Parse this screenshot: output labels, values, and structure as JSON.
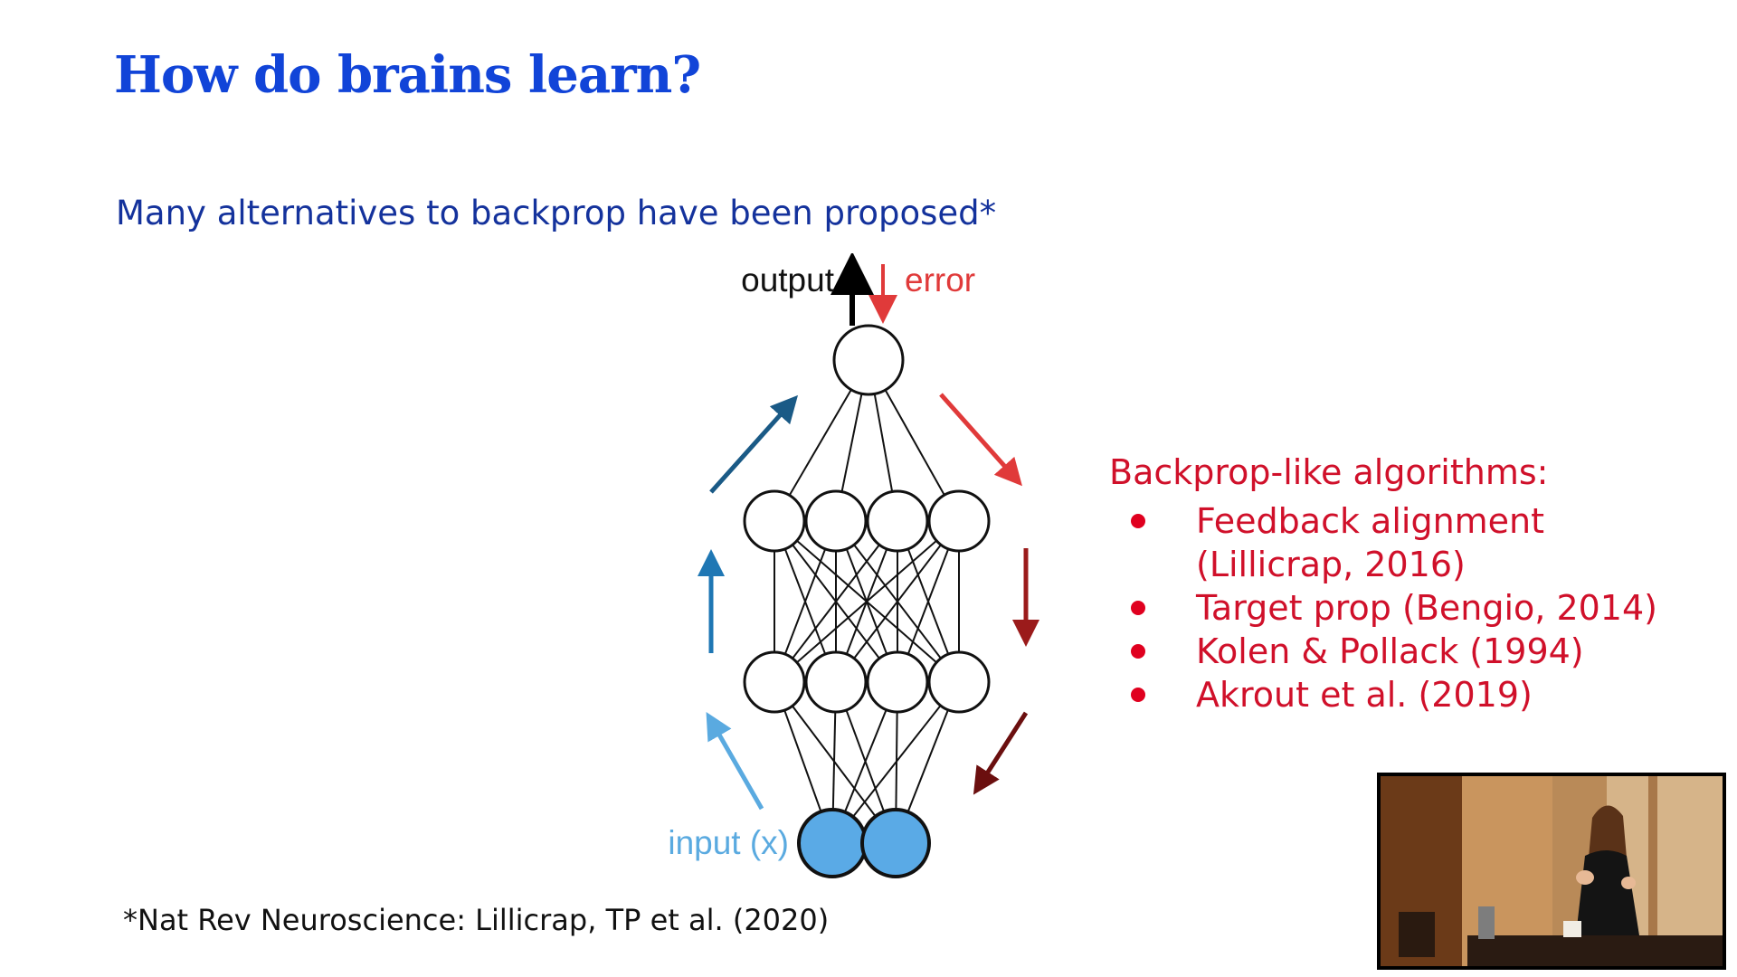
{
  "slide": {
    "title": "How do brains learn?",
    "subtitle": "Many alternatives to backprop have been proposed*",
    "footnote": "*Nat Rev Neuroscience: Lillicrap, TP et al. (2020)"
  },
  "diagram": {
    "output_label": "output",
    "error_label": "error",
    "input_label": "input (x)",
    "colors": {
      "error_red": "#e03a3a",
      "forward_dark_blue": "#1a5a86",
      "forward_mid_blue": "#1f77b4",
      "forward_light_blue": "#5aaae0",
      "input_node_fill": "#5aaae6",
      "backward_dark_red": "#9b1b1b",
      "backward_darker_red": "#6b0f0f"
    }
  },
  "side_list": {
    "heading": "Backprop-like algorithms:",
    "items": [
      "Feedback alignment (Lillicrap, 2016)",
      "Target prop (Bengio, 2014)",
      "Kolen & Pollack (1994)",
      "Akrout et al. (2019)"
    ],
    "color": "#d0102a"
  },
  "webcam": {
    "description_icon": "speaker-video-icon"
  }
}
